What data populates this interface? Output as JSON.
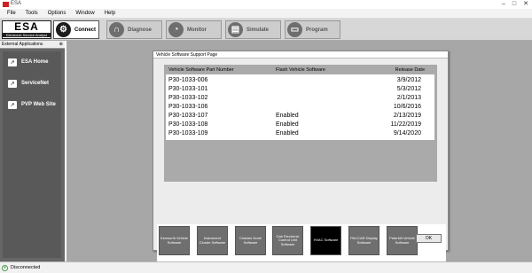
{
  "window": {
    "title": "ESA",
    "controls": [
      "–",
      "□",
      "✕"
    ]
  },
  "menu": [
    "File",
    "Tools",
    "Options",
    "Window",
    "Help"
  ],
  "logo": {
    "text": "ESA",
    "subtitle": "Electronic Service Analyst"
  },
  "toolbar": [
    {
      "label": "Connect",
      "icon": "connect-icon",
      "active": true
    },
    {
      "label": "Diagnose",
      "icon": "stethoscope-icon",
      "active": false
    },
    {
      "label": "Monitor",
      "icon": "gauge-icon",
      "active": false
    },
    {
      "label": "Simulate",
      "icon": "simulate-icon",
      "active": false
    },
    {
      "label": "Program",
      "icon": "monitor-icon",
      "active": false
    }
  ],
  "sidebar": {
    "header": "External Applications",
    "pin": "⊕",
    "items": [
      {
        "label": "ESA Home",
        "icon": "link-icon"
      },
      {
        "label": "ServiceNet",
        "icon": "link-icon"
      },
      {
        "label": "PVP Web Site",
        "icon": "link-icon"
      }
    ]
  },
  "dialog": {
    "title": "Vehicle Software Support Page",
    "headers": {
      "part": "Vehicle Software Part Number",
      "flash": "Flash Vehicle Software",
      "date": "Release Date"
    },
    "rows": [
      {
        "part": "P30-1033-006",
        "flash": "",
        "date": "3/9/2012"
      },
      {
        "part": "P30-1033-101",
        "flash": "",
        "date": "5/3/2012"
      },
      {
        "part": "P30-1033-102",
        "flash": "",
        "date": "2/1/2013"
      },
      {
        "part": "P30-1033-106",
        "flash": "",
        "date": "10/6/2016"
      },
      {
        "part": "P30-1033-107",
        "flash": "Enabled",
        "date": "2/13/2019"
      },
      {
        "part": "P30-1033-108",
        "flash": "Enabled",
        "date": "11/22/2019"
      },
      {
        "part": "P30-1033-109",
        "flash": "Enabled",
        "date": "9/14/2020"
      }
    ],
    "software_buttons": [
      "Kenworth Vehicle Software",
      "Instrument Cluster Software",
      "Chassis Node Software",
      "Cab Electronic Control Unit Software",
      "HVAC Software",
      "PACCAR Display Software",
      "Peterbilt Vehicle Software"
    ],
    "selected_button": 4,
    "ok_label": "OK"
  },
  "status": {
    "text": "Disconnected",
    "icon": "status-icon"
  }
}
